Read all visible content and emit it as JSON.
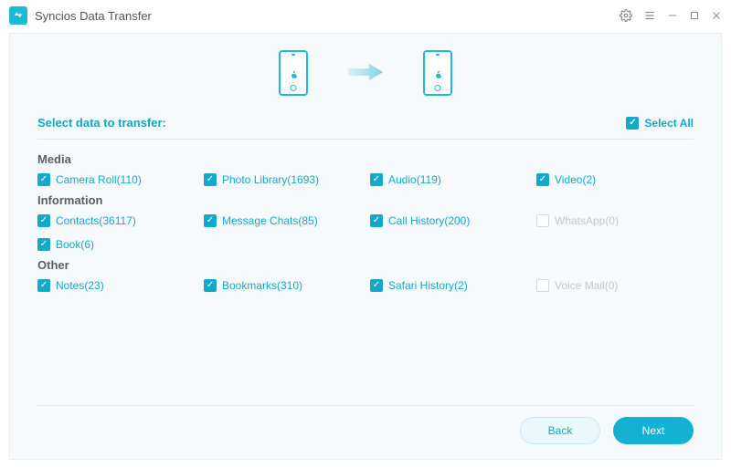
{
  "window": {
    "title": "Syncios Data Transfer"
  },
  "header": {
    "select_title": "Select data to transfer:",
    "select_all": "Select All"
  },
  "sections": {
    "media": {
      "title": "Media",
      "items": [
        {
          "label": "Camera Roll(110)",
          "checked": true,
          "enabled": true
        },
        {
          "label": "Photo Library(1693)",
          "checked": true,
          "enabled": true
        },
        {
          "label": "Audio(119)",
          "checked": true,
          "enabled": true
        },
        {
          "label": "Video(2)",
          "checked": true,
          "enabled": true
        }
      ]
    },
    "information": {
      "title": "Information",
      "items": [
        {
          "label": "Contacts(36117)",
          "checked": true,
          "enabled": true
        },
        {
          "label": "Message Chats(85)",
          "checked": true,
          "enabled": true
        },
        {
          "label": "Call History(200)",
          "checked": true,
          "enabled": true
        },
        {
          "label": "WhatsApp(0)",
          "checked": false,
          "enabled": false
        },
        {
          "label": "Book(6)",
          "checked": true,
          "enabled": true
        }
      ]
    },
    "other": {
      "title": "Other",
      "items": [
        {
          "label": "Notes(23)",
          "checked": true,
          "enabled": true
        },
        {
          "label": "Bookmarks(310)",
          "checked": true,
          "enabled": true
        },
        {
          "label": "Safari History(2)",
          "checked": true,
          "enabled": true
        },
        {
          "label": "Voice Mail(0)",
          "checked": false,
          "enabled": false
        }
      ]
    }
  },
  "footer": {
    "back": "Back",
    "next": "Next"
  }
}
